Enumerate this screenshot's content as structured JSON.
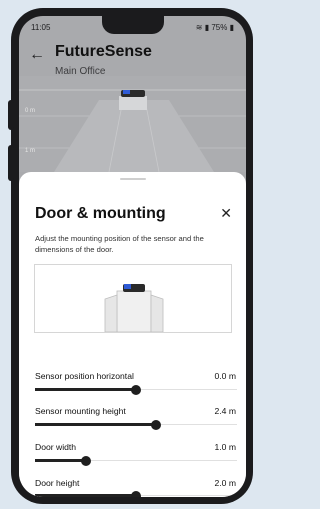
{
  "status_bar": {
    "time": "11:05",
    "right": "75%"
  },
  "header": {
    "title": "FutureSense",
    "subtitle": "Main Office"
  },
  "room_view": {
    "axis_labels": [
      "0 m",
      "1 m"
    ]
  },
  "sheet": {
    "title": "Door & mounting",
    "close_glyph": "✕",
    "description": "Adjust the mounting position of the sensor and the dimensions of the door."
  },
  "controls": [
    {
      "label": "Sensor position horizontal",
      "value": "0.0 m",
      "level": 0.5
    },
    {
      "label": "Sensor mounting height",
      "value": "2.4 m",
      "level": 0.6
    },
    {
      "label": "Door width",
      "value": "1.0 m",
      "level": 0.25
    },
    {
      "label": "Door height",
      "value": "2.0 m",
      "level": 0.5
    }
  ],
  "icons": [
    "back-arrow-icon",
    "close-icon",
    "wifi-icon",
    "signal-icon",
    "battery-icon"
  ],
  "colors": {
    "accent": "#1f1f1f",
    "sensor_glow": "#2f5bd6"
  }
}
